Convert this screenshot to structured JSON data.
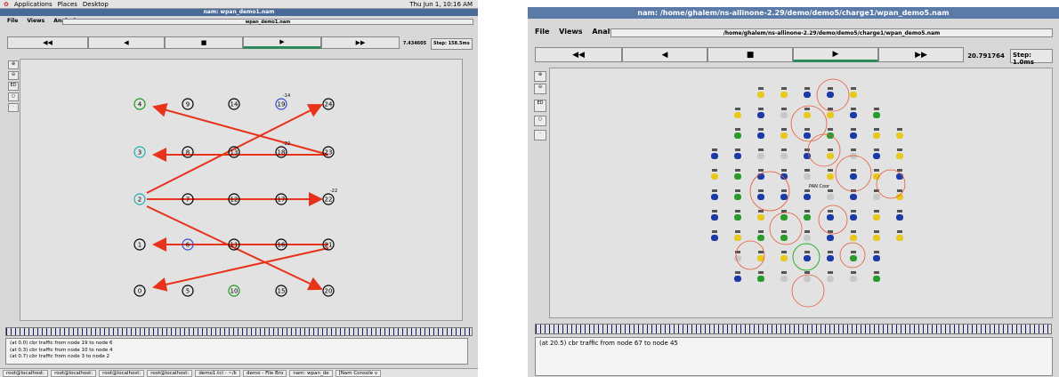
{
  "left": {
    "gnome_menu": [
      "Applications",
      "Places",
      "Desktop"
    ],
    "clock": "Thu Jun 1, 10:16 AM",
    "window_title": "nam: wpan_demo1.nam",
    "menu": [
      "File",
      "Views",
      "Analysis"
    ],
    "file_field": "wpan_demo1.nam",
    "controls": [
      "◀◀",
      "◀",
      "■",
      "▶",
      "▶▶"
    ],
    "time": "7.434605",
    "step": "Step: 158.5ms",
    "log": [
      "(at 0.0) cbr traffic from node 19 to node 6",
      "(at 0.3) cbr traffic from node 10 to node 4",
      "(at 0.7) cbr traffic from node 3 to node 2"
    ],
    "taskbar": [
      "root@localhost:",
      "root@localhost:",
      "root@localhost:",
      "root@localhost:",
      "demo1.tcl - ~/k",
      "demo - File Bro",
      "nam: wpan_de",
      "[Nam Console v"
    ],
    "colors": {
      "green": "#1a9a1a",
      "cyan": "#1ab0b0",
      "blue": "#3a4ad0",
      "arrow": "#e8321a"
    },
    "node_labels": {
      "n19": "-14",
      "n18": "-22",
      "n22": "-22"
    }
  },
  "right": {
    "window_title": "nam: /home/ghalem/ns-allinone-2.29/demo/demo5/charge1/wpan_demo5.nam",
    "menu": [
      "File",
      "Views",
      "Analysis"
    ],
    "file_field": "/home/ghalem/ns-allinone-2.29/demo/demo5/charge1/wpan_demo5.nam",
    "controls": [
      "◀◀",
      "◀",
      "■",
      "▶",
      "▶▶"
    ],
    "time": "20.791764",
    "step": "Step: 1.0ms",
    "pan_label": "PAN Coor",
    "log": [
      "(at 20.5) cbr traffic from node 67 to node 45"
    ]
  }
}
